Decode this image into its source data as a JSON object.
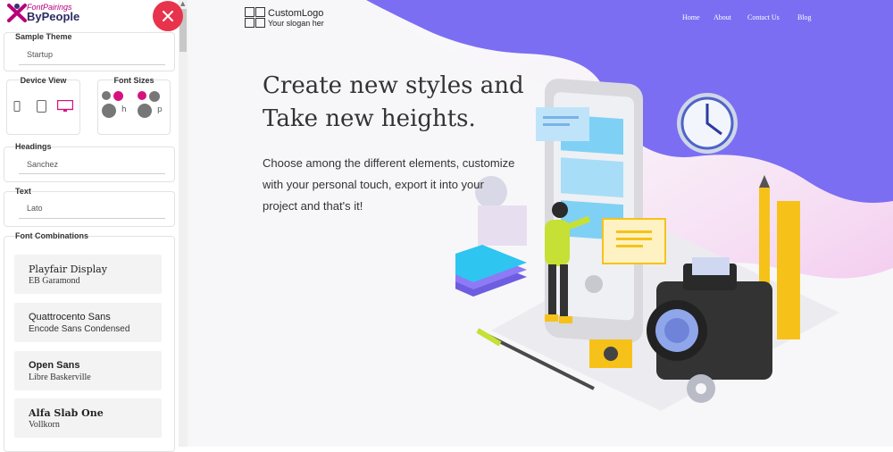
{
  "brand": {
    "line1": "FontPairings",
    "line2": "ByPeople"
  },
  "panel": {
    "sample_theme": {
      "label": "Sample Theme",
      "value": "Startup"
    },
    "device_view": {
      "label": "Device View"
    },
    "font_sizes": {
      "label": "Font Sizes",
      "h_label": "h",
      "p_label": "p"
    },
    "headings": {
      "label": "Headings",
      "value": "Sanchez"
    },
    "text": {
      "label": "Text",
      "value": "Lato"
    },
    "font_combinations": {
      "label": "Font Combinations",
      "items": [
        {
          "primary": "Playfair Display",
          "secondary": "EB Garamond"
        },
        {
          "primary": "Quattrocento Sans",
          "secondary": "Encode Sans Condensed"
        },
        {
          "primary": "Open Sans",
          "secondary": "Libre Baskerville"
        },
        {
          "primary": "Alfa Slab One",
          "secondary": "Vollkorn"
        }
      ]
    }
  },
  "preview": {
    "logo": {
      "title": "CustomLogo",
      "slogan": "Your slogan her"
    },
    "nav": [
      "Home",
      "About",
      "Contact Us",
      "Blog"
    ],
    "headline_1": "Create new styles and",
    "headline_2": "Take new heights.",
    "desc_1": "Choose among the different elements, customize",
    "desc_2": "with your personal touch, export it into your",
    "desc_3": "project and that's it!"
  },
  "colors": {
    "accent": "#e8334c",
    "blob": "#7b6ef2",
    "pink": "#d6127f"
  }
}
